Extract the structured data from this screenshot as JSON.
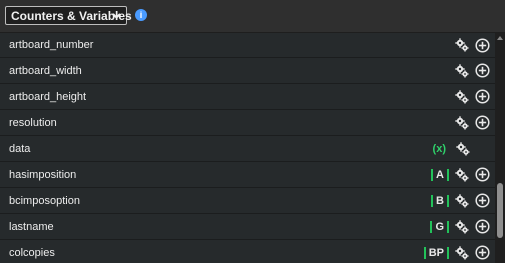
{
  "header": {
    "dropdown_label": "Counters & Variables",
    "info_glyph": "i",
    "accent_color": "#4a9bff"
  },
  "rows": [
    {
      "name": "artboard_number",
      "tag": "",
      "has_x": false,
      "has_plus": true
    },
    {
      "name": "artboard_width",
      "tag": "",
      "has_x": false,
      "has_plus": true
    },
    {
      "name": "artboard_height",
      "tag": "",
      "has_x": false,
      "has_plus": true
    },
    {
      "name": "resolution",
      "tag": "",
      "has_x": false,
      "has_plus": true
    },
    {
      "name": "data",
      "tag": "",
      "has_x": true,
      "x_label": "(x)",
      "has_plus": false
    },
    {
      "name": "hasimposition",
      "tag": "A",
      "has_x": false,
      "has_plus": true
    },
    {
      "name": "bcimposoption",
      "tag": "B",
      "has_x": false,
      "has_plus": true
    },
    {
      "name": "lastname",
      "tag": "G",
      "has_x": false,
      "has_plus": true
    },
    {
      "name": "colcopies",
      "tag": "BP",
      "has_x": false,
      "has_plus": true
    }
  ],
  "icons": {
    "gear": "gears-icon",
    "plus": "add-circle-icon",
    "chevron": "chevron-down-icon"
  },
  "colors": {
    "tag_bar": "#22c25a",
    "x_label": "#2fd16b"
  }
}
